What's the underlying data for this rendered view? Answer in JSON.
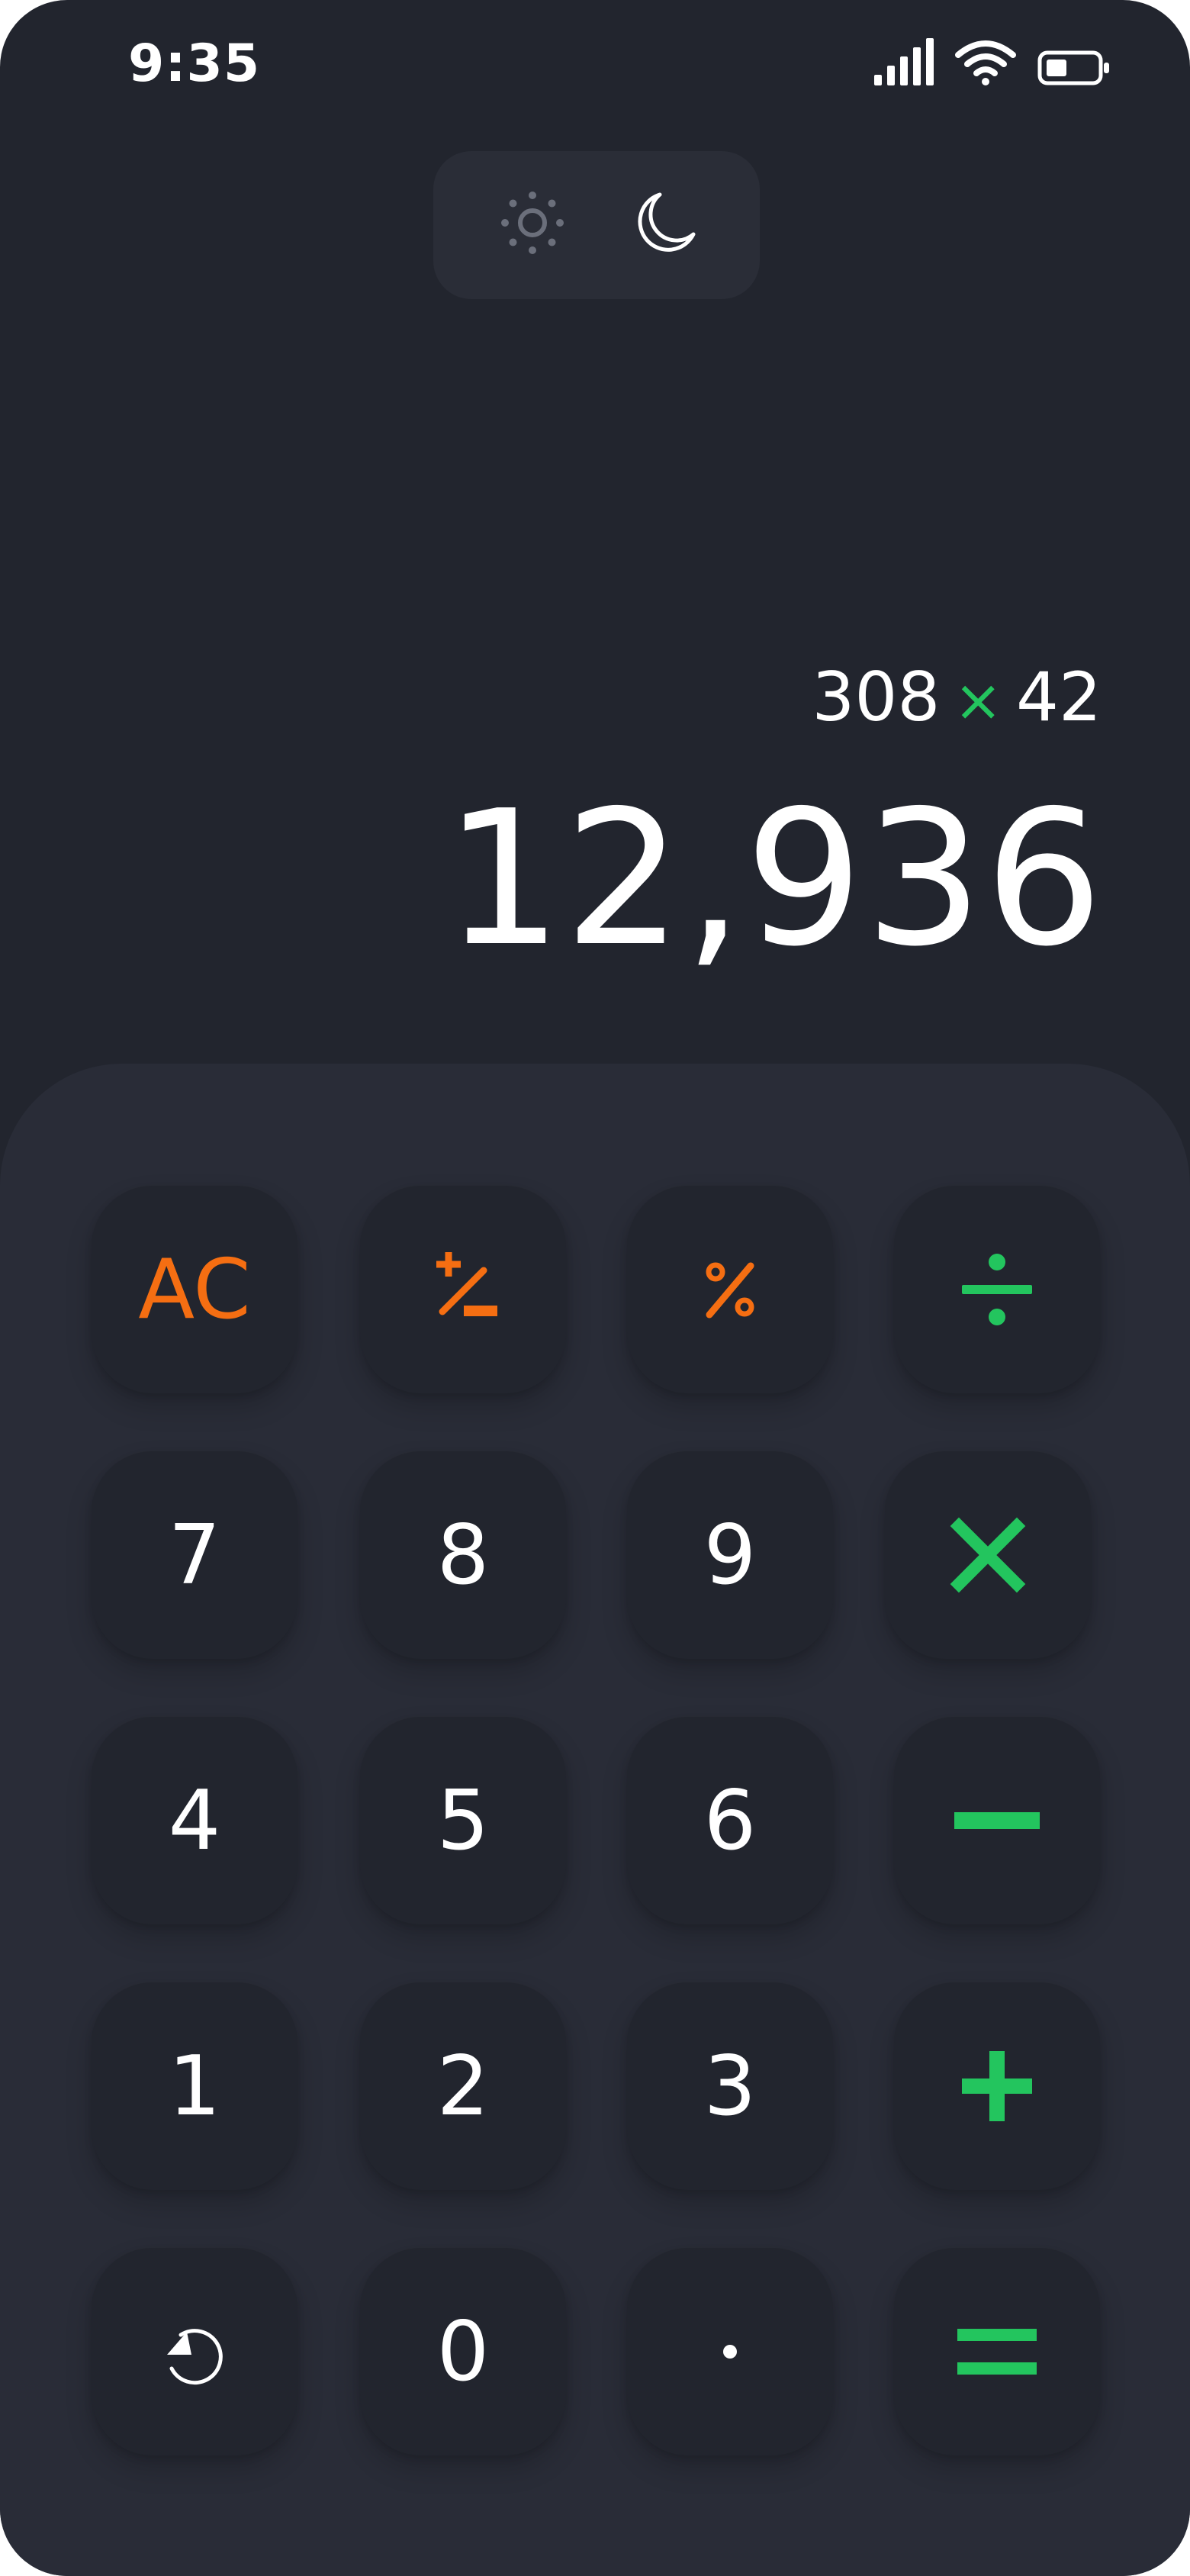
{
  "status_bar": {
    "time": "9:35",
    "icons": [
      "signal-icon",
      "wifi-icon",
      "battery-icon"
    ]
  },
  "theme_toggle": {
    "options": [
      "sun-icon",
      "moon-icon"
    ],
    "active": "moon-icon"
  },
  "display": {
    "expression_left": "308",
    "expression_operator": "×",
    "expression_right": "42",
    "result": "12,936"
  },
  "keypad": {
    "rows": [
      [
        "AC",
        "plus-minus-icon",
        "percent-icon",
        "divide-icon"
      ],
      [
        "7",
        "8",
        "9",
        "multiply-icon"
      ],
      [
        "4",
        "5",
        "6",
        "minus-icon"
      ],
      [
        "1",
        "2",
        "3",
        "plus-icon"
      ],
      [
        "undo-icon",
        "0",
        ".",
        "equals-icon"
      ]
    ],
    "labels": {
      "ac": "AC",
      "seven": "7",
      "eight": "8",
      "nine": "9",
      "four": "4",
      "five": "5",
      "six": "6",
      "one": "1",
      "two": "2",
      "three": "3",
      "zero": "0"
    }
  },
  "colors": {
    "background": "#22252e",
    "keypad_panel": "#292c37",
    "key": "#22252e",
    "function_accent": "#f56e12",
    "operator_accent": "#23c55e",
    "text": "#ffffff"
  }
}
